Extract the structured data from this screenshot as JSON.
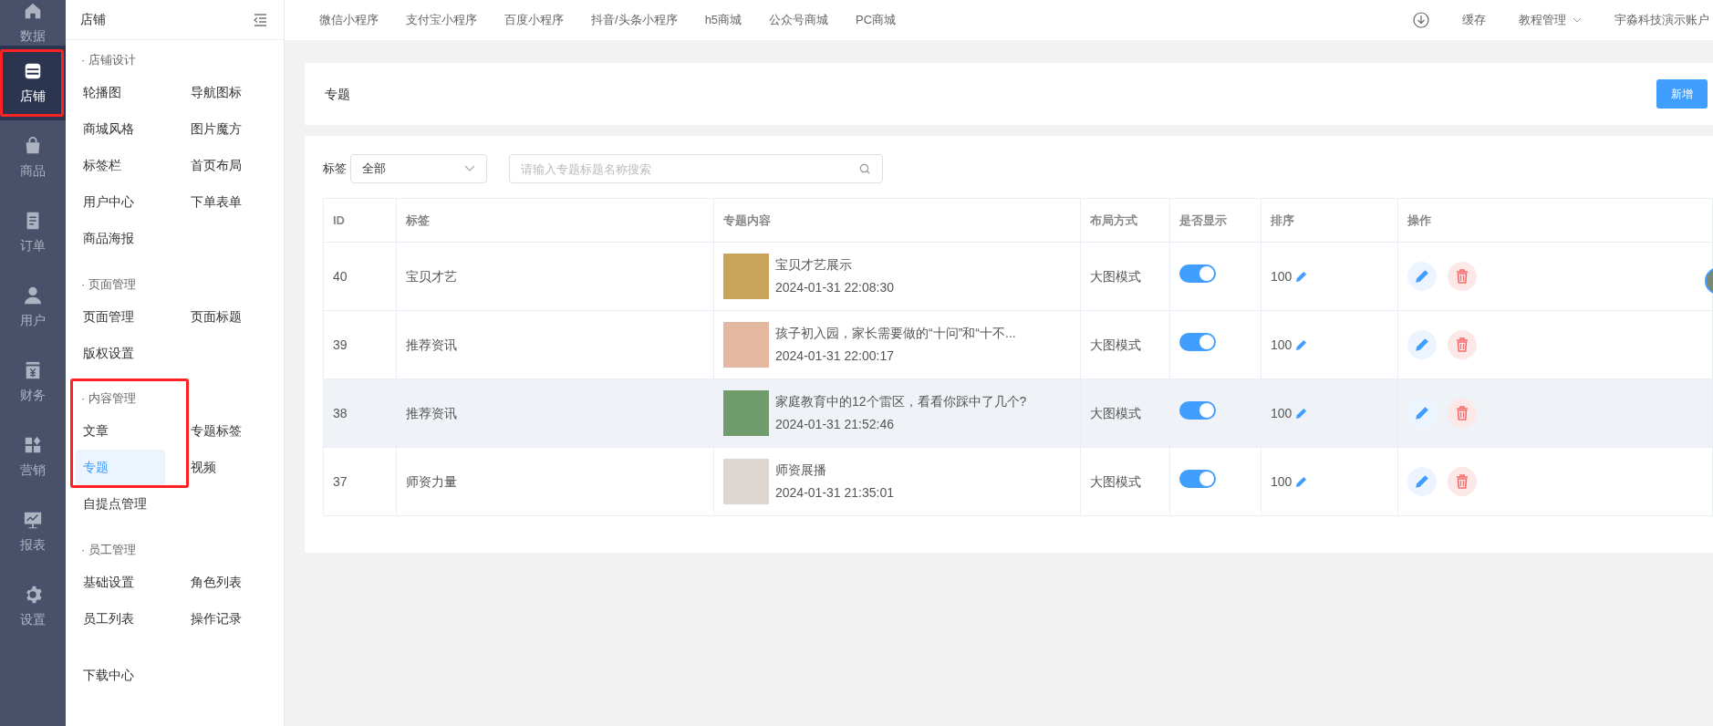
{
  "rail": [
    {
      "label": "数据",
      "selected": false
    },
    {
      "label": "店铺",
      "selected": true
    },
    {
      "label": "商品",
      "selected": false
    },
    {
      "label": "订单",
      "selected": false
    },
    {
      "label": "用户",
      "selected": false
    },
    {
      "label": "财务",
      "selected": false
    },
    {
      "label": "营销",
      "selected": false
    },
    {
      "label": "报表",
      "selected": false
    },
    {
      "label": "设置",
      "selected": false
    }
  ],
  "sidebar": {
    "title": "店铺",
    "sections": [
      {
        "title": "· 店铺设计",
        "items": [
          {
            "label": "轮播图",
            "selected": false
          },
          {
            "label": "导航图标",
            "selected": false
          },
          {
            "label": "商城风格",
            "selected": false
          },
          {
            "label": "图片魔方",
            "selected": false
          },
          {
            "label": "标签栏",
            "selected": false
          },
          {
            "label": "首页布局",
            "selected": false
          },
          {
            "label": "用户中心",
            "selected": false
          },
          {
            "label": "下单表单",
            "selected": false
          },
          {
            "label": "商品海报",
            "selected": false
          }
        ]
      },
      {
        "title": "· 页面管理",
        "items": [
          {
            "label": "页面管理",
            "selected": false
          },
          {
            "label": "页面标题",
            "selected": false
          },
          {
            "label": "版权设置",
            "selected": false
          }
        ]
      },
      {
        "title": "· 内容管理",
        "items": [
          {
            "label": "文章",
            "selected": false
          },
          {
            "label": "专题标签",
            "selected": false
          },
          {
            "label": "专题",
            "selected": true
          },
          {
            "label": "视频",
            "selected": false
          },
          {
            "label": "自提点管理",
            "selected": false
          }
        ]
      },
      {
        "title": "· 员工管理",
        "items": [
          {
            "label": "基础设置",
            "selected": false
          },
          {
            "label": "角色列表",
            "selected": false
          },
          {
            "label": "员工列表",
            "selected": false
          },
          {
            "label": "操作记录",
            "selected": false
          }
        ]
      },
      {
        "items": [
          {
            "label": "下载中心",
            "selected": false
          }
        ]
      }
    ]
  },
  "topbar": {
    "tabs": [
      "微信小程序",
      "支付宝小程序",
      "百度小程序",
      "抖音/头条小程序",
      "h5商城",
      "公众号商城",
      "PC商城"
    ],
    "cache": "缓存",
    "menu": "教程管理",
    "account": "宇淼科技演示账户"
  },
  "page": {
    "title": "专题",
    "add_button": "新增"
  },
  "filter": {
    "label": "标签",
    "select_value": "全部",
    "search_placeholder": "请输入专题标题名称搜索"
  },
  "table": {
    "columns": [
      "ID",
      "标签",
      "专题内容",
      "布局方式",
      "是否显示",
      "排序",
      "操作"
    ],
    "rows": [
      {
        "id": "40",
        "tag": "宝贝才艺",
        "title": "宝贝才艺展示",
        "time": "2024-01-31 22:08:30",
        "layout": "大图模式",
        "shown": true,
        "sort": "100",
        "highlighted": false
      },
      {
        "id": "39",
        "tag": "推荐资讯",
        "title": "孩子初入园，家长需要做的“十问”和“十不...",
        "time": "2024-01-31 22:00:17",
        "layout": "大图模式",
        "shown": true,
        "sort": "100",
        "highlighted": false
      },
      {
        "id": "38",
        "tag": "推荐资讯",
        "title": "家庭教育中的12个雷区，看看你踩中了几个?",
        "time": "2024-01-31 21:52:46",
        "layout": "大图模式",
        "shown": true,
        "sort": "100",
        "highlighted": true
      },
      {
        "id": "37",
        "tag": "师资力量",
        "title": "师资展播",
        "time": "2024-01-31 21:35:01",
        "layout": "大图模式",
        "shown": true,
        "sort": "100",
        "highlighted": false
      }
    ]
  }
}
